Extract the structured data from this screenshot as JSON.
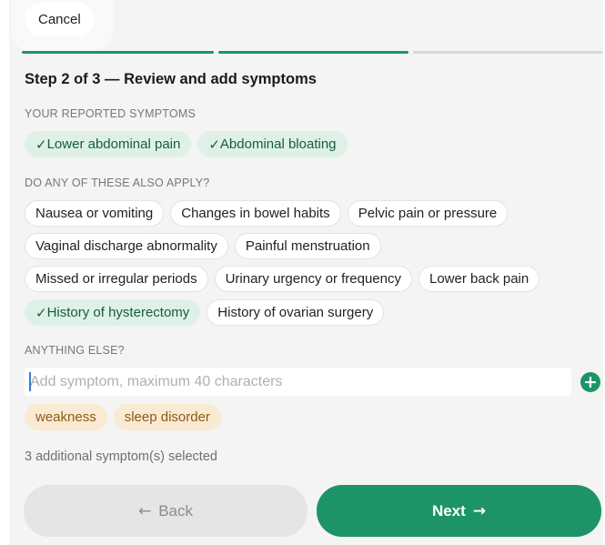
{
  "colors": {
    "accent": "#1d9467",
    "progress_inactive": "#d7d7d7"
  },
  "cancel_label": "Cancel",
  "progress": {
    "current_step": 2,
    "total_steps": 3
  },
  "step_title": "Step 2 of 3 — Review and add symptoms",
  "reported": {
    "label": "YOUR REPORTED SYMPTOMS",
    "check_glyph": "✓",
    "chips": [
      "Lower abdominal pain",
      "Abdominal bloating"
    ]
  },
  "also_apply": {
    "label": "DO ANY OF THESE ALSO APPLY?",
    "rows": [
      [
        {
          "label": "Nausea or vomiting",
          "selected": false
        },
        {
          "label": "Changes in bowel habits",
          "selected": false
        },
        {
          "label": "Pelvic pain or pressure",
          "selected": false
        }
      ],
      [
        {
          "label": "Vaginal discharge abnormality",
          "selected": false
        },
        {
          "label": "Painful menstruation",
          "selected": false
        }
      ],
      [
        {
          "label": "Missed or irregular periods",
          "selected": false
        },
        {
          "label": "Urinary urgency or frequency",
          "selected": false
        },
        {
          "label": "Lower back pain",
          "selected": false
        }
      ],
      [
        {
          "label": "History of hysterectomy",
          "selected": true
        },
        {
          "label": "History of ovarian surgery",
          "selected": false
        }
      ]
    ]
  },
  "anything_else": {
    "label": "ANYTHING ELSE?",
    "placeholder": "Add symptom, maximum 40 characters",
    "value": "",
    "add_icon": "plus-circle-icon",
    "add_glyph": "+",
    "custom_chips": [
      "weakness",
      "sleep disorder"
    ]
  },
  "selected_count_text": "3 additional symptom(s) selected",
  "nav": {
    "back_label": "Back",
    "back_arrow": "←",
    "next_label": "Next",
    "next_arrow": "→"
  }
}
